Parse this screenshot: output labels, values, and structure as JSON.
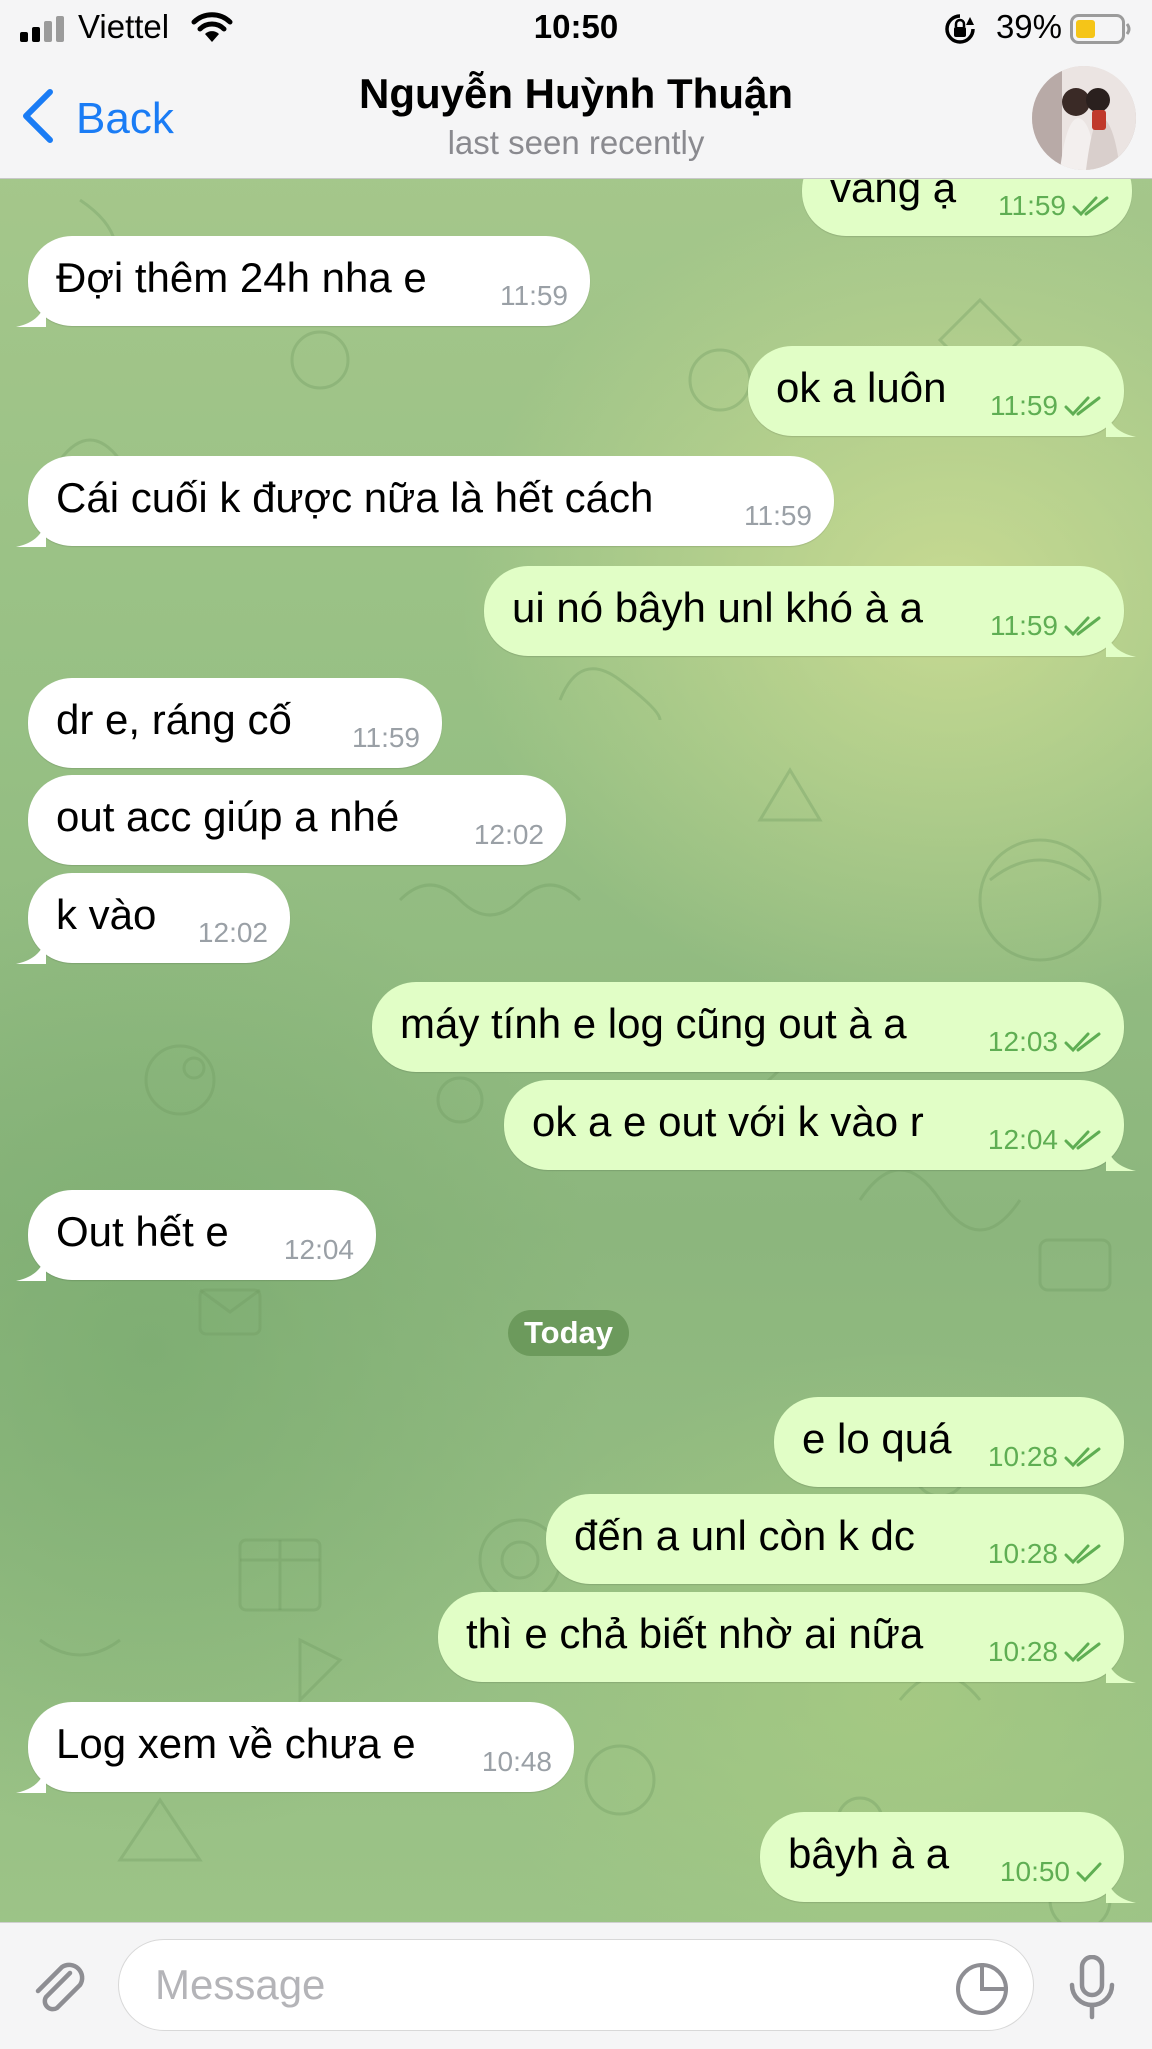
{
  "status_bar": {
    "carrier": "Viettel",
    "time": "10:50",
    "battery_percent": "39%",
    "battery_color": "#f5c518",
    "icons": [
      "signal-icon",
      "wifi-icon",
      "orientation-lock-icon",
      "battery-icon"
    ]
  },
  "header": {
    "back_label": "Back",
    "title": "Nguyễn Huỳnh Thuận",
    "subtitle": "last seen recently"
  },
  "colors": {
    "accent": "#1a7cf5",
    "incoming_bubble": "#ffffff",
    "outgoing_bubble": "#e1fec6",
    "read_check": "#5fae53",
    "date_pill": "#6c9a5c"
  },
  "messages": [
    {
      "direction": "out",
      "text": "vâng ạ",
      "time": "11:59",
      "status": "read"
    },
    {
      "direction": "in",
      "text": "Đợi thêm 24h nha e",
      "time": "11:59"
    },
    {
      "direction": "out",
      "text": "ok a luôn",
      "time": "11:59",
      "status": "read"
    },
    {
      "direction": "in",
      "text": "Cái cuối k được nữa là hết cách",
      "time": "11:59"
    },
    {
      "direction": "out",
      "text": "ui nó bâyh unl khó à a",
      "time": "11:59",
      "status": "read"
    },
    {
      "direction": "in",
      "text": "dr e, ráng cố",
      "time": "11:59"
    },
    {
      "direction": "in",
      "text": "out acc giúp a nhé",
      "time": "12:02"
    },
    {
      "direction": "in",
      "text": "k vào",
      "time": "12:02"
    },
    {
      "direction": "out",
      "text": "máy tính e log cũng out à a",
      "time": "12:03",
      "status": "read"
    },
    {
      "direction": "out",
      "text": "ok a e out với k vào r",
      "time": "12:04",
      "status": "read"
    },
    {
      "direction": "in",
      "text": "Out hết e",
      "time": "12:04"
    },
    {
      "direction": "out",
      "text": "e lo quá",
      "time": "10:28",
      "status": "read"
    },
    {
      "direction": "out",
      "text": "đến a unl còn k dc",
      "time": "10:28",
      "status": "read"
    },
    {
      "direction": "out",
      "text": "thì e chả biết nhờ ai nữa",
      "time": "10:28",
      "status": "read"
    },
    {
      "direction": "in",
      "text": "Log xem về chưa e",
      "time": "10:48"
    },
    {
      "direction": "out",
      "text": "bâyh à a",
      "time": "10:50",
      "status": "delivered"
    }
  ],
  "date_separator": "Today",
  "input_bar": {
    "placeholder": "Message",
    "value": "",
    "icons": [
      "paperclip-icon",
      "sticker-icon",
      "microphone-icon"
    ]
  }
}
